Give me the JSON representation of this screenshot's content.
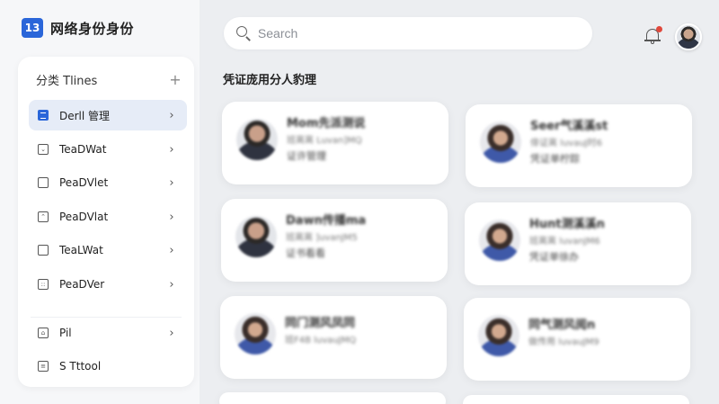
{
  "app": {
    "badge": "13",
    "title": "网络身份身份"
  },
  "nav": {
    "header": "分类 Tlines",
    "add_glyph": "+",
    "chevron_glyph": "›",
    "items": [
      {
        "label": "Derll 管理",
        "icon": "document-icon",
        "active": true
      },
      {
        "label": "TeaDWat",
        "icon": "inbox-icon"
      },
      {
        "label": "PeaDVlet",
        "icon": "square-icon"
      },
      {
        "label": "PeaDVlat",
        "icon": "upload-icon"
      },
      {
        "label": "TeaLWat",
        "icon": "square-icon"
      },
      {
        "label": "PeaDVer",
        "icon": "grid-icon"
      },
      {
        "label": "Pil",
        "icon": "bag-icon"
      },
      {
        "label": "S Tttool",
        "icon": "list-icon"
      }
    ]
  },
  "search": {
    "placeholder": "Search",
    "value": ""
  },
  "main": {
    "section_title": "凭证庞用分人豹理",
    "cards": [
      {
        "name": "Mom先派测说",
        "meta": "班离离 Luvan]MQ",
        "role": "证许管理",
        "avatar": "male"
      },
      {
        "name": "Seer气溪溪st",
        "meta": "俳证离 luvauJ时6",
        "role": "凭证单柠踪",
        "avatar": "female"
      },
      {
        "name": "Dawn传播ma",
        "meta": "班离离 ]uvanJM5",
        "role": "证书看看",
        "avatar": "male"
      },
      {
        "name": "Hunt测溪溪n",
        "meta": "班离离 luvanJM6",
        "role": "凭证单徐办",
        "avatar": "female"
      },
      {
        "name": "同门测风凤同",
        "meta": "班F4B luvauJMQ",
        "role": "",
        "avatar": "female"
      },
      {
        "name": "同气测风阅n",
        "meta": "做传用 luvauJM9",
        "role": "",
        "avatar": "female"
      }
    ]
  }
}
